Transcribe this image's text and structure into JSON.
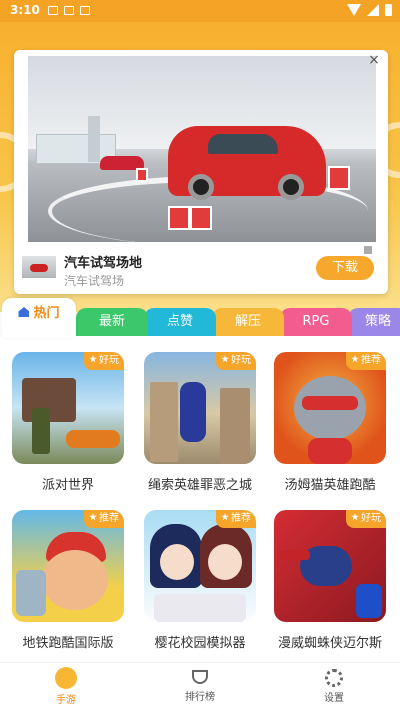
{
  "status_bar": {
    "time": "3:10"
  },
  "ad": {
    "close_label": "×",
    "title": "汽车试驾场地",
    "subtitle": "汽车试驾场",
    "download_label": "下载"
  },
  "tabs": [
    {
      "label": "热门",
      "active": true,
      "color": "#ffffff"
    },
    {
      "label": "最新",
      "color": "#3cc86a"
    },
    {
      "label": "点赞",
      "color": "#22b8d8"
    },
    {
      "label": "解压",
      "color": "#f7b83a"
    },
    {
      "label": "RPG",
      "color": "#f35c8f"
    },
    {
      "label": "策略",
      "color": "#9b87e8"
    }
  ],
  "games": [
    {
      "name": "派对世界",
      "tag": "好玩"
    },
    {
      "name": "绳索英雄罪恶之城",
      "tag": "好玩"
    },
    {
      "name": "汤姆猫英雄跑酷",
      "tag": "推荐"
    },
    {
      "name": "地铁跑酷国际版",
      "tag": "推荐"
    },
    {
      "name": "樱花校园模拟器",
      "tag": "推荐"
    },
    {
      "name": "漫威蜘蛛侠迈尔斯",
      "tag": "好玩"
    }
  ],
  "bottom_nav": [
    {
      "label": "手游",
      "active": true
    },
    {
      "label": "排行榜"
    },
    {
      "label": "设置"
    }
  ],
  "colors": {
    "accent": "#f5a325",
    "header_bg": "#f8b02e",
    "download_button": "#f6a82c"
  }
}
